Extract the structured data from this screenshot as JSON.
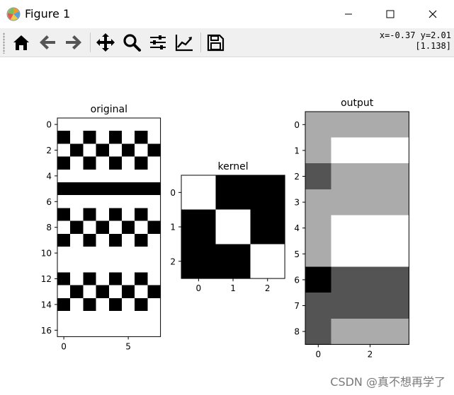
{
  "window": {
    "title": "Figure 1",
    "controls": [
      "minimize",
      "maximize",
      "close"
    ]
  },
  "toolbar": {
    "buttons": [
      {
        "name": "home",
        "icon": "home-icon"
      },
      {
        "name": "back",
        "icon": "arrow-left-icon"
      },
      {
        "name": "forward",
        "icon": "arrow-right-icon"
      },
      {
        "name": "pan",
        "icon": "move-icon"
      },
      {
        "name": "zoom",
        "icon": "magnifier-icon"
      },
      {
        "name": "configure-subplots",
        "icon": "sliders-icon"
      },
      {
        "name": "edit-axis",
        "icon": "line-chart-icon"
      },
      {
        "name": "save",
        "icon": "floppy-disk-icon"
      }
    ],
    "coords_line1": "x=-0.37 y=2.01",
    "coords_line2": "[1.138]"
  },
  "watermark": "CSDN @真不想再学了",
  "chart_data": [
    {
      "type": "heatmap",
      "title": "original",
      "colormap": "gray",
      "xticks": [
        "0",
        "5"
      ],
      "yticks": [
        "0",
        "2",
        "4",
        "6",
        "8",
        "10",
        "12",
        "14",
        "16"
      ],
      "matrix": [
        [
          1,
          1,
          1,
          1,
          1,
          1,
          1,
          1
        ],
        [
          0,
          1,
          0,
          1,
          0,
          1,
          0,
          1
        ],
        [
          1,
          0,
          1,
          0,
          1,
          0,
          1,
          0
        ],
        [
          0,
          1,
          0,
          1,
          0,
          1,
          0,
          1
        ],
        [
          1,
          1,
          1,
          1,
          1,
          1,
          1,
          1
        ],
        [
          0,
          0,
          0,
          0,
          0,
          0,
          0,
          0
        ],
        [
          1,
          1,
          1,
          1,
          1,
          1,
          1,
          1
        ],
        [
          0,
          1,
          0,
          1,
          0,
          1,
          0,
          1
        ],
        [
          1,
          0,
          1,
          0,
          1,
          0,
          1,
          0
        ],
        [
          0,
          1,
          0,
          1,
          0,
          1,
          0,
          1
        ],
        [
          1,
          1,
          1,
          1,
          1,
          1,
          1,
          1
        ],
        [
          1,
          1,
          1,
          1,
          1,
          1,
          1,
          1
        ],
        [
          0,
          1,
          0,
          1,
          0,
          1,
          0,
          1
        ],
        [
          1,
          0,
          1,
          0,
          1,
          0,
          1,
          0
        ],
        [
          0,
          1,
          0,
          1,
          0,
          1,
          0,
          1
        ],
        [
          1,
          1,
          1,
          1,
          1,
          1,
          1,
          1
        ],
        [
          1,
          1,
          1,
          1,
          1,
          1,
          1,
          1
        ]
      ]
    },
    {
      "type": "heatmap",
      "title": "kernel",
      "colormap": "gray",
      "xticks": [
        "0",
        "1",
        "2"
      ],
      "yticks": [
        "0",
        "1",
        "2"
      ],
      "matrix": [
        [
          1,
          0,
          0
        ],
        [
          0,
          1,
          0
        ],
        [
          0,
          0,
          1
        ]
      ]
    },
    {
      "type": "heatmap",
      "title": "output",
      "colormap": "gray",
      "xticks": [
        "0",
        "2"
      ],
      "yticks": [
        "0",
        "1",
        "2",
        "3",
        "4",
        "5",
        "6",
        "7",
        "8"
      ],
      "matrix": [
        [
          0.67,
          0.67,
          0.67,
          0.67
        ],
        [
          0.67,
          1,
          1,
          1
        ],
        [
          0.33,
          0.67,
          0.67,
          0.67
        ],
        [
          0.67,
          0.67,
          0.67,
          0.67
        ],
        [
          0.67,
          1,
          1,
          1
        ],
        [
          0.67,
          1,
          1,
          1
        ],
        [
          0,
          0.33,
          0.33,
          0.33
        ],
        [
          0.33,
          0.33,
          0.33,
          0.33
        ],
        [
          0.33,
          0.67,
          0.67,
          0.67
        ]
      ]
    }
  ]
}
